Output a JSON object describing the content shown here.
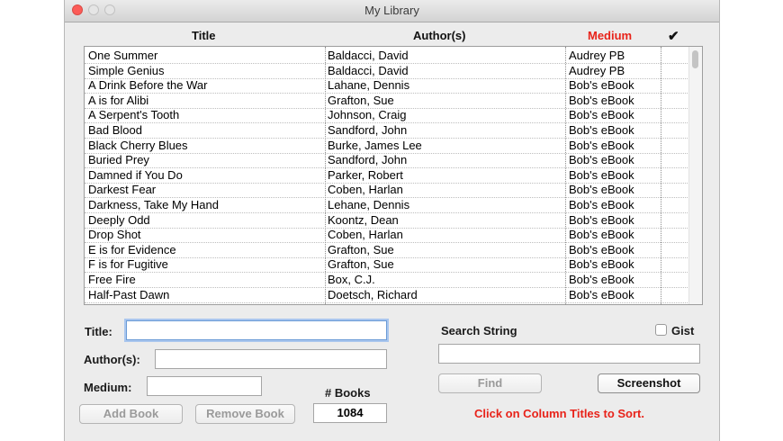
{
  "window": {
    "title": "My Library"
  },
  "table": {
    "headers": {
      "title": "Title",
      "authors": "Author(s)",
      "medium": "Medium",
      "check": "✔"
    },
    "medium_header_color": "#e8231a",
    "rows": [
      {
        "title": "One Summer",
        "author": "Baldacci, David",
        "medium": "Audrey PB",
        "checked": true
      },
      {
        "title": "Simple Genius",
        "author": "Baldacci, David",
        "medium": "Audrey PB",
        "checked": true
      },
      {
        "title": "A Drink Before the War",
        "author": "Lahane, Dennis",
        "medium": "Bob's eBook",
        "checked": true
      },
      {
        "title": "A is for Alibi",
        "author": "Grafton, Sue",
        "medium": "Bob's eBook",
        "checked": true
      },
      {
        "title": "A Serpent's Tooth",
        "author": "Johnson, Craig",
        "medium": "Bob's eBook",
        "checked": true
      },
      {
        "title": "Bad Blood",
        "author": "Sandford, John",
        "medium": "Bob's eBook",
        "checked": true
      },
      {
        "title": "Black Cherry Blues",
        "author": "Burke, James Lee",
        "medium": "Bob's eBook",
        "checked": true
      },
      {
        "title": "Buried Prey",
        "author": "Sandford, John",
        "medium": "Bob's eBook",
        "checked": true
      },
      {
        "title": "Damned if You Do",
        "author": "Parker, Robert",
        "medium": "Bob's eBook",
        "checked": true
      },
      {
        "title": "Darkest Fear",
        "author": "Coben, Harlan",
        "medium": "Bob's eBook",
        "checked": true
      },
      {
        "title": "Darkness, Take My Hand",
        "author": "Lehane, Dennis",
        "medium": "Bob's eBook",
        "checked": true
      },
      {
        "title": "Deeply Odd",
        "author": "Koontz, Dean",
        "medium": "Bob's eBook",
        "checked": true
      },
      {
        "title": "Drop Shot",
        "author": "Coben, Harlan",
        "medium": "Bob's eBook",
        "checked": true
      },
      {
        "title": "E is for Evidence",
        "author": "Grafton, Sue",
        "medium": "Bob's eBook",
        "checked": true
      },
      {
        "title": "F is for Fugitive",
        "author": "Grafton, Sue",
        "medium": "Bob's eBook",
        "checked": true
      },
      {
        "title": "Free Fire",
        "author": "Box, C.J.",
        "medium": "Bob's eBook",
        "checked": true
      },
      {
        "title": "Half-Past Dawn",
        "author": "Doetsch, Richard",
        "medium": "Bob's eBook",
        "checked": true
      }
    ]
  },
  "form": {
    "title_label": "Title:",
    "authors_label": "Author(s):",
    "medium_label": "Medium:",
    "title_value": "",
    "authors_value": "",
    "medium_value": "",
    "books_count_label": "# Books",
    "books_count": "1084",
    "add_book": "Add Book",
    "remove_book": "Remove Book"
  },
  "search": {
    "label": "Search String",
    "value": "",
    "gist_label": "Gist",
    "gist_checked": false,
    "find": "Find",
    "screenshot": "Screenshot",
    "hint": "Click on Column Titles to Sort.",
    "hint_color": "#e8231a"
  }
}
